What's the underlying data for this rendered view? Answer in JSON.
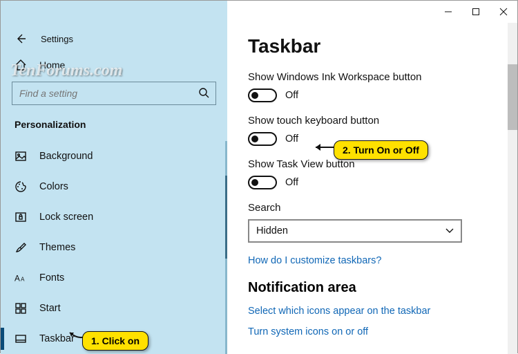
{
  "window": {
    "title": "Settings"
  },
  "sidebar": {
    "home": "Home",
    "search_placeholder": "Find a setting",
    "category": "Personalization",
    "items": [
      {
        "label": "Background"
      },
      {
        "label": "Colors"
      },
      {
        "label": "Lock screen"
      },
      {
        "label": "Themes"
      },
      {
        "label": "Fonts"
      },
      {
        "label": "Start"
      },
      {
        "label": "Taskbar"
      }
    ]
  },
  "page": {
    "title": "Taskbar",
    "settings": [
      {
        "label": "Show Windows Ink Workspace button",
        "state": "Off"
      },
      {
        "label": "Show touch keyboard button",
        "state": "Off"
      },
      {
        "label": "Show Task View button",
        "state": "Off"
      }
    ],
    "search_label": "Search",
    "search_value": "Hidden",
    "link_customize": "How do I customize taskbars?",
    "section_notification": "Notification area",
    "link_icons": "Select which icons appear on the taskbar",
    "link_system_icons": "Turn system icons on or off"
  },
  "callouts": {
    "c1": "1. Click on",
    "c2": "2. Turn On or Off"
  },
  "watermark": "TenForums.com"
}
